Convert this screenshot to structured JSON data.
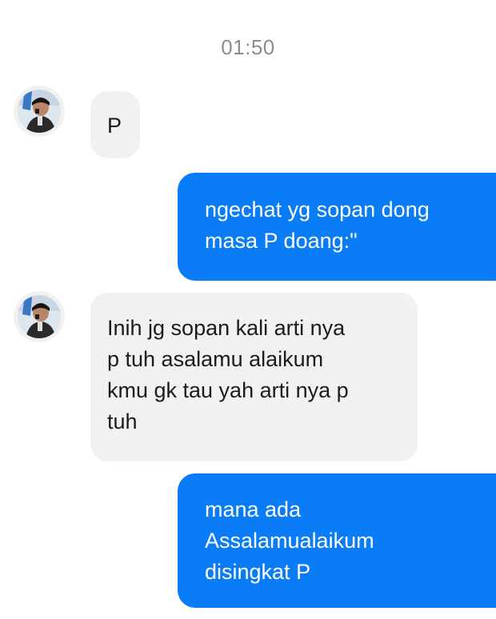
{
  "conversation": {
    "timestamp": "01:50",
    "messages": [
      {
        "sender": "other",
        "text": "P"
      },
      {
        "sender": "me",
        "lines": [
          "ngechat yg sopan dong",
          "masa P doang:\""
        ]
      },
      {
        "sender": "other",
        "lines": [
          "Inih jg sopan kali arti nya",
          "p tuh asalamu alaikum",
          "kmu gk tau yah arti nya p",
          "tuh"
        ]
      },
      {
        "sender": "me",
        "lines": [
          "mana ada",
          "Assalamualaikum",
          "disingkat P"
        ]
      }
    ]
  },
  "colors": {
    "outgoing_bubble": "#0a7cf6",
    "incoming_bubble": "#f1f1f3",
    "timestamp_text": "#8d8d8d"
  },
  "icons": {
    "avatar": "contact-avatar-photo"
  }
}
